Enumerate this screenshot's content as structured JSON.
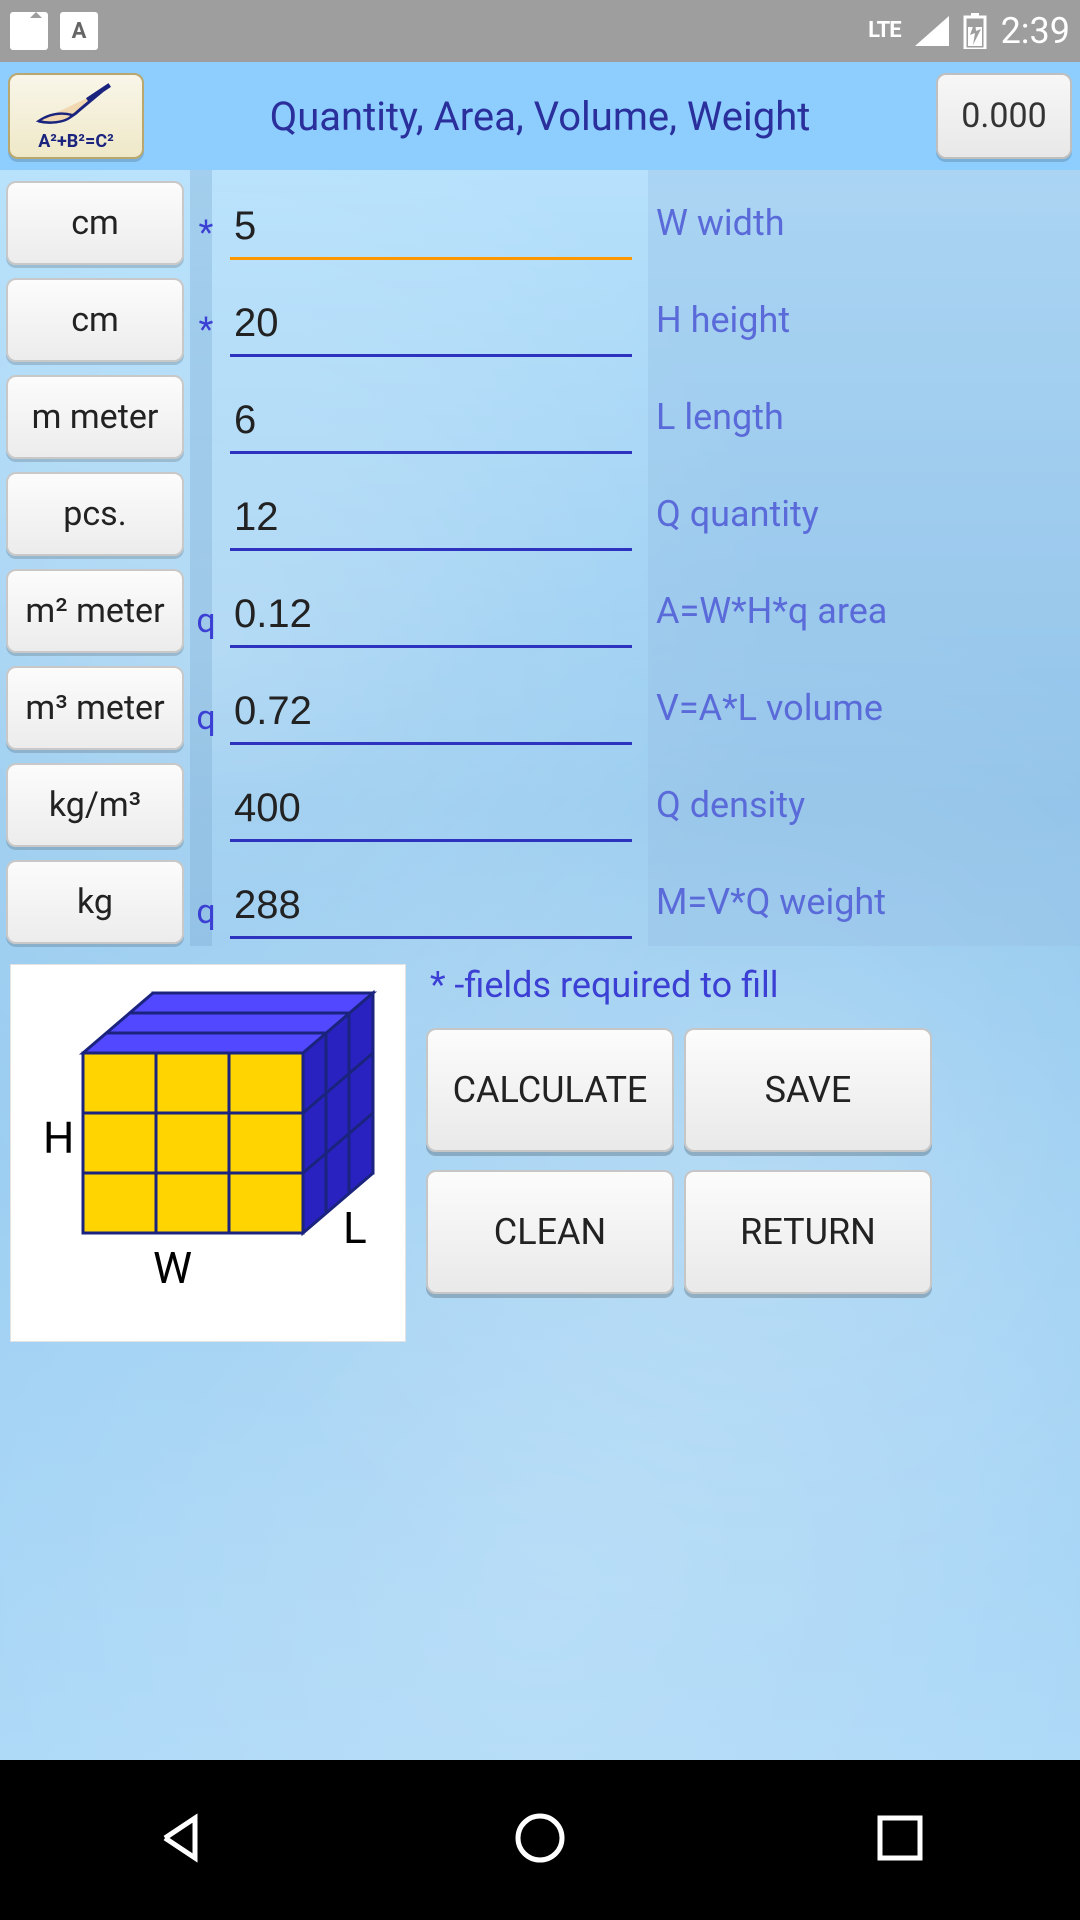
{
  "status": {
    "lte": "LTE",
    "time": "2:39"
  },
  "header": {
    "formula": "A²+B²=C²",
    "title": "Quantity, Area, Volume, Weight",
    "value": "0.000"
  },
  "rows": [
    {
      "unit": "cm",
      "sym": "*",
      "val": "5",
      "label": "W width"
    },
    {
      "unit": "cm",
      "sym": "*",
      "val": "20",
      "label": "H height"
    },
    {
      "unit": "m meter",
      "sym": "",
      "val": "6",
      "label": "L length"
    },
    {
      "unit": "pcs.",
      "sym": "",
      "val": "12",
      "label": "Q quantity"
    },
    {
      "unit": "m² meter",
      "sym": "q",
      "val": "0.12",
      "label": "A=W*H*q area"
    },
    {
      "unit": "m³ meter",
      "sym": "q",
      "val": "0.72",
      "label": "V=A*L volume"
    },
    {
      "unit": "kg/m³",
      "sym": "",
      "val": "400",
      "label": "Q density"
    },
    {
      "unit": "kg",
      "sym": "q",
      "val": "288",
      "label": "M=V*Q weight"
    }
  ],
  "footnote": "* -fields required to fill",
  "diagram": {
    "H": "H",
    "W": "W",
    "L": "L"
  },
  "buttons": {
    "calculate": "CALCULATE",
    "save": "SAVE",
    "clean": "CLEAN",
    "return": "RETURN"
  }
}
